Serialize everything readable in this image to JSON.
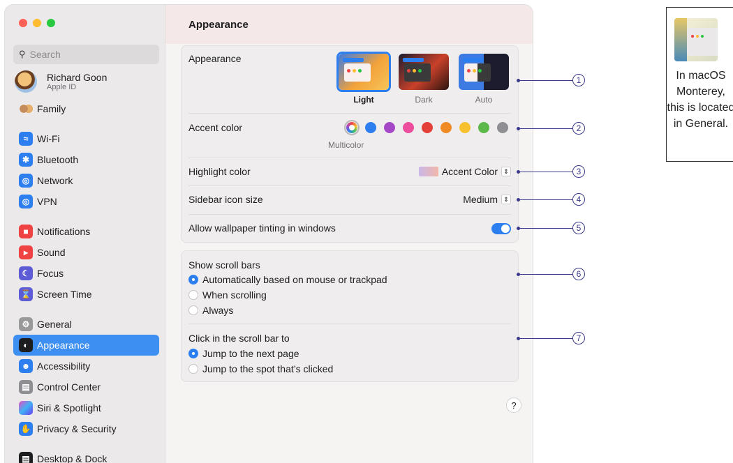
{
  "sidebar": {
    "search_placeholder": "Search",
    "profile": {
      "name": "Richard Goon",
      "sub": "Apple ID"
    },
    "items": [
      {
        "label": "Family",
        "icon": "family-icon"
      },
      {
        "label": "Wi-Fi",
        "icon": "wifi-icon"
      },
      {
        "label": "Bluetooth",
        "icon": "bluetooth-icon"
      },
      {
        "label": "Network",
        "icon": "network-icon"
      },
      {
        "label": "VPN",
        "icon": "vpn-icon"
      },
      {
        "label": "Notifications",
        "icon": "notifications-icon"
      },
      {
        "label": "Sound",
        "icon": "sound-icon"
      },
      {
        "label": "Focus",
        "icon": "focus-icon"
      },
      {
        "label": "Screen Time",
        "icon": "screen-time-icon"
      },
      {
        "label": "General",
        "icon": "general-icon"
      },
      {
        "label": "Appearance",
        "icon": "appearance-icon",
        "selected": true
      },
      {
        "label": "Accessibility",
        "icon": "accessibility-icon"
      },
      {
        "label": "Control Center",
        "icon": "control-center-icon"
      },
      {
        "label": "Siri & Spotlight",
        "icon": "siri-icon"
      },
      {
        "label": "Privacy & Security",
        "icon": "privacy-icon"
      },
      {
        "label": "Desktop & Dock",
        "icon": "desktop-dock-icon"
      }
    ]
  },
  "main": {
    "title": "Appearance",
    "appearance": {
      "label": "Appearance",
      "options": [
        {
          "label": "Light",
          "selected": true
        },
        {
          "label": "Dark",
          "selected": false
        },
        {
          "label": "Auto",
          "selected": false
        }
      ]
    },
    "accent": {
      "label": "Accent color",
      "selected_name": "Multicolor",
      "colors": [
        "#2d7ff0",
        "#a548c7",
        "#ec4d9c",
        "#e4403a",
        "#f08a24",
        "#f7c12e",
        "#5db84a",
        "#8e8e93"
      ]
    },
    "highlight": {
      "label": "Highlight color",
      "value": "Accent Color"
    },
    "sidebar_icon_size": {
      "label": "Sidebar icon size",
      "value": "Medium"
    },
    "wallpaper_tinting": {
      "label": "Allow wallpaper tinting in windows",
      "on": true
    },
    "scroll_bars": {
      "label": "Show scroll bars",
      "options": [
        {
          "label": "Automatically based on mouse or trackpad",
          "selected": true
        },
        {
          "label": "When scrolling",
          "selected": false
        },
        {
          "label": "Always",
          "selected": false
        }
      ]
    },
    "click_scroll": {
      "label": "Click in the scroll bar to",
      "options": [
        {
          "label": "Jump to the next page",
          "selected": true
        },
        {
          "label": "Jump to the spot that’s clicked",
          "selected": false
        }
      ]
    },
    "help_label": "?"
  },
  "callouts": [
    "1",
    "2",
    "3",
    "4",
    "5",
    "6",
    "7"
  ],
  "note": {
    "text": "In macOS Monterey, this is located in General."
  }
}
